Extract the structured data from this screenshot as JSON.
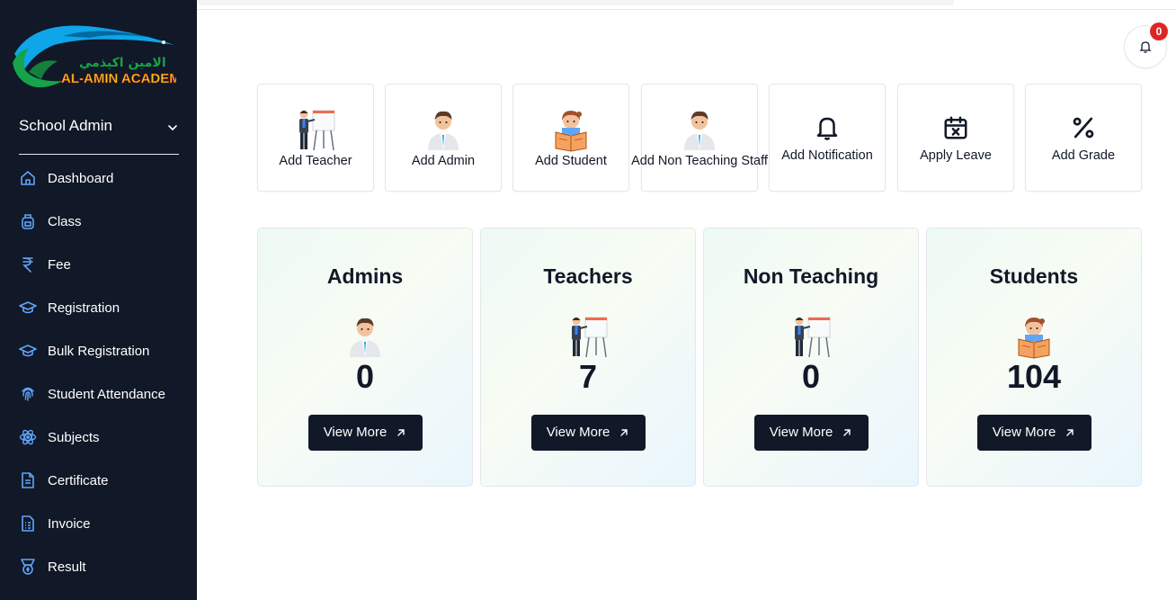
{
  "brand": {
    "arabic_name": "الامين اكيذمي",
    "name": "AL-AMIN ACADEMY"
  },
  "sidebar": {
    "role": "School Admin",
    "items": [
      {
        "label": "Dashboard",
        "icon": "home-icon"
      },
      {
        "label": "Class",
        "icon": "backpack-icon"
      },
      {
        "label": "Fee",
        "icon": "rupee-icon"
      },
      {
        "label": "Registration",
        "icon": "graduation-cap-icon"
      },
      {
        "label": "Bulk Registration",
        "icon": "graduation-cap-icon"
      },
      {
        "label": "Student Attendance",
        "icon": "fingerprint-icon"
      },
      {
        "label": "Subjects",
        "icon": "atom-icon"
      },
      {
        "label": "Certificate",
        "icon": "document-icon"
      },
      {
        "label": "Invoice",
        "icon": "receipt-icon"
      },
      {
        "label": "Result",
        "icon": "medal-icon"
      }
    ]
  },
  "notifications": {
    "count": "0"
  },
  "quick_actions": [
    {
      "label": "Add Teacher",
      "icon": "teacher-board-icon"
    },
    {
      "label": "Add Admin",
      "icon": "admin-person-icon"
    },
    {
      "label": "Add Student",
      "icon": "student-reading-icon"
    },
    {
      "label": "Add Non Teaching Staff",
      "icon": "staff-person-icon"
    },
    {
      "label": "Add Notification",
      "icon": "bell-icon"
    },
    {
      "label": "Apply Leave",
      "icon": "calendar-x-icon"
    },
    {
      "label": "Add Grade",
      "icon": "percent-icon"
    }
  ],
  "stats": [
    {
      "title": "Admins",
      "count": "0",
      "button": "View More",
      "icon": "admin-person-icon"
    },
    {
      "title": "Teachers",
      "count": "7",
      "button": "View More",
      "icon": "teacher-board-icon"
    },
    {
      "title": "Non Teaching",
      "count": "0",
      "button": "View More",
      "icon": "teacher-board-icon"
    },
    {
      "title": "Students",
      "count": "104",
      "button": "View More",
      "icon": "student-reading-icon"
    }
  ],
  "colors": {
    "sidebar_bg": "#111827",
    "accent": "#60a5fa",
    "badge": "#dc2626",
    "button_bg": "#111827"
  }
}
